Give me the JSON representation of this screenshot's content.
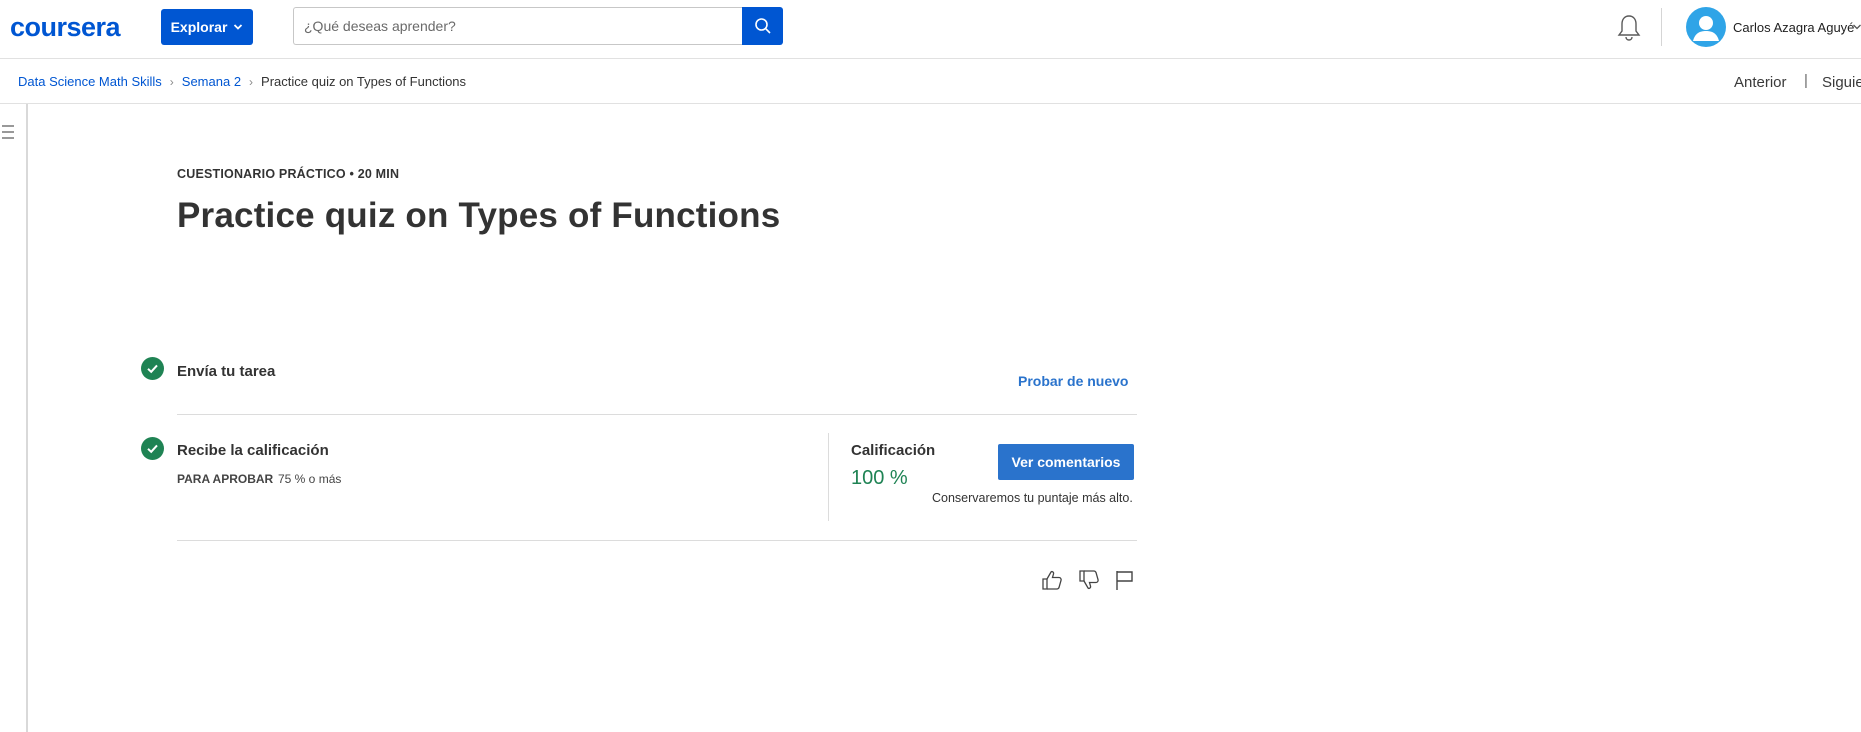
{
  "header": {
    "logo": "coursera",
    "explore_label": "Explorar",
    "search_placeholder": "¿Qué deseas aprender?",
    "user_name": "Carlos Azagra Aguyé",
    "icons": [
      "chevron-down-icon",
      "search-icon",
      "bell-icon",
      "user-avatar-icon"
    ]
  },
  "breadcrumb": {
    "items": [
      "Data Science Math Skills",
      "Semana 2"
    ],
    "current": "Practice quiz on Types of Functions",
    "prev_label": "Anterior",
    "separator": "|",
    "next_label": "Siguie"
  },
  "main": {
    "eyebrow": "CUESTIONARIO PRÁCTICO • 20 MIN",
    "title": "Practice quiz on Types of Functions",
    "step1": {
      "title": "Envía tu tarea",
      "action": "Probar de nuevo"
    },
    "step2": {
      "title": "Recibe la calificación",
      "pass_label": "PARA APROBAR",
      "pass_value": "75 % o más",
      "grade_label": "Calificación",
      "grade_value": "100 %",
      "feedback_button": "Ver comentarios",
      "keep_note": "Conservaremos tu puntaje más alto."
    },
    "feedback_icons": [
      "thumbs-up-icon",
      "thumbs-down-icon",
      "flag-icon"
    ]
  },
  "colors": {
    "brand_blue": "#0056d2",
    "link_blue": "#2a73cc",
    "success_green": "#1f8354"
  }
}
